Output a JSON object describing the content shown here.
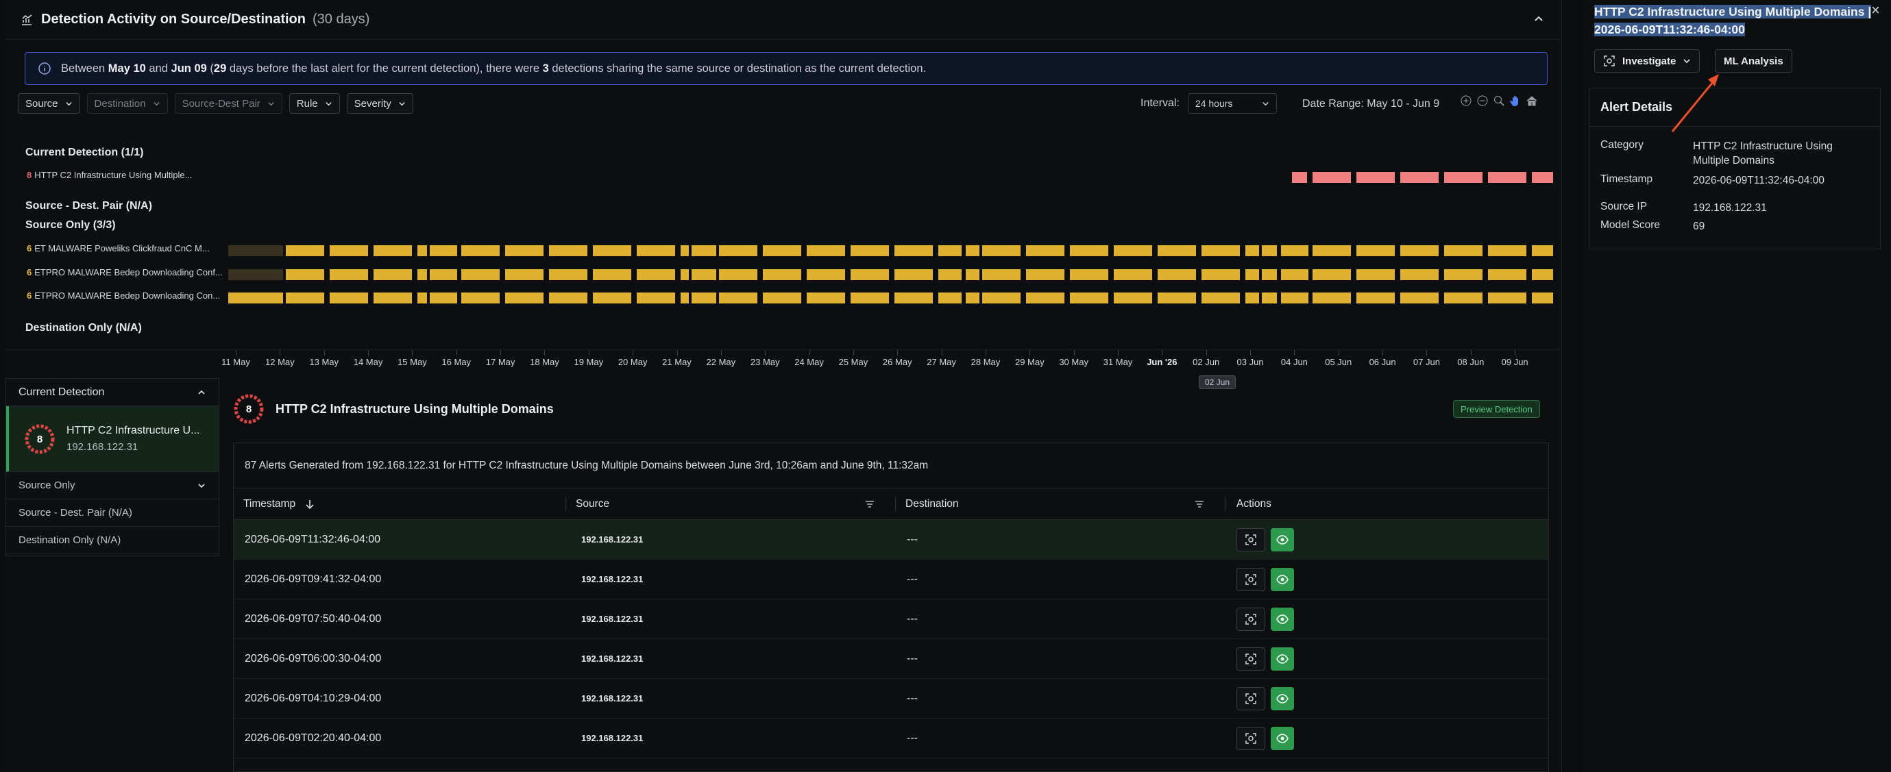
{
  "header": {
    "title": "Detection Activity on Source/Destination",
    "subtitle": "(30 days)"
  },
  "banner": {
    "text_before": "Between ",
    "start": "May 10",
    "and": " and ",
    "end": "Jun 09",
    "days_open": " (",
    "days": "29",
    "text_middle": " days before the last alert for the current detection), there were ",
    "count": "3",
    "text_after": " detections sharing the same source or destination as the current detection."
  },
  "filters": [
    {
      "label": "Source",
      "dim": false
    },
    {
      "label": "Destination",
      "dim": true
    },
    {
      "label": "Source-Dest Pair",
      "dim": true
    },
    {
      "label": "Rule",
      "dim": false
    },
    {
      "label": "Severity",
      "dim": false
    }
  ],
  "interval": {
    "label": "Interval:",
    "value": "24 hours"
  },
  "date_range": "Date Range: May 10 - Jun 9",
  "timeline": {
    "current_label": "Current Detection (1/1)",
    "current_row": {
      "count": "8",
      "name": "HTTP C2 Infrastructure Using Multiple..."
    },
    "pair_label": "Source - Dest. Pair (N/A)",
    "source_only_label": "Source Only (3/3)",
    "source_rows": [
      {
        "count": "6",
        "name": "ET MALWARE Poweliks Clickfraud CnC M..."
      },
      {
        "count": "6",
        "name": "ETPRO MALWARE Bedep Downloading Conf..."
      },
      {
        "count": "6",
        "name": "ETPRO MALWARE Bedep Downloading Con..."
      }
    ],
    "dest_only_label": "Destination Only (N/A)",
    "ticks": [
      "11 May",
      "12 May",
      "13 May",
      "14 May",
      "15 May",
      "16 May",
      "17 May",
      "18 May",
      "19 May",
      "20 May",
      "21 May",
      "22 May",
      "23 May",
      "24 May",
      "25 May",
      "26 May",
      "27 May",
      "28 May",
      "29 May",
      "30 May",
      "31 May",
      "Jun '26",
      "02 Jun",
      "03 Jun",
      "04 Jun",
      "05 Jun",
      "06 Jun",
      "07 Jun",
      "08 Jun",
      "09 Jun"
    ],
    "cursor_label": "02 Jun",
    "colors": {
      "current": "#f08080",
      "source": "#e0b030",
      "faded": "#3a3220"
    }
  },
  "nav": {
    "current_label": "Current Detection",
    "current_score": "8",
    "current_name": "HTTP C2 Infrastructure U...",
    "current_ip": "192.168.122.31",
    "source_only": "Source Only",
    "pair": "Source - Dest. Pair (N/A)",
    "dest_only": "Destination Only (N/A)"
  },
  "detail": {
    "score": "8",
    "title": "HTTP C2 Infrastructure Using Multiple Domains",
    "preview_label": "Preview Detection",
    "summary": "87 Alerts Generated from 192.168.122.31 for HTTP C2 Infrastructure Using Multiple Domains between June 3rd, 10:26am and June 9th, 11:32am",
    "columns": {
      "timestamp": "Timestamp",
      "source": "Source",
      "destination": "Destination",
      "actions": "Actions"
    },
    "rows": [
      {
        "ts": "2026-06-09T11:32:46-04:00",
        "src": "192.168.122.31",
        "dst": "---"
      },
      {
        "ts": "2026-06-09T09:41:32-04:00",
        "src": "192.168.122.31",
        "dst": "---"
      },
      {
        "ts": "2026-06-09T07:50:40-04:00",
        "src": "192.168.122.31",
        "dst": "---"
      },
      {
        "ts": "2026-06-09T06:00:30-04:00",
        "src": "192.168.122.31",
        "dst": "---"
      },
      {
        "ts": "2026-06-09T04:10:29-04:00",
        "src": "192.168.122.31",
        "dst": "---"
      },
      {
        "ts": "2026-06-09T02:20:40-04:00",
        "src": "192.168.122.31",
        "dst": "---"
      }
    ]
  },
  "side": {
    "title": "HTTP C2 Infrastructure Using Multiple Domains | 2026-06-09T11:32:46-04:00",
    "investigate_label": "Investigate",
    "ml_label": "ML Analysis",
    "close": "×",
    "card_title": "Alert Details",
    "fields": {
      "category_k": "Category",
      "category_v": "HTTP C2 Infrastructure Using Multiple Domains",
      "timestamp_k": "Timestamp",
      "timestamp_v": "2026-06-09T11:32:46-04:00",
      "source_ip_k": "Source IP",
      "source_ip_v": "192.168.122.31",
      "model_score_k": "Model Score",
      "model_score_v": "69"
    }
  }
}
